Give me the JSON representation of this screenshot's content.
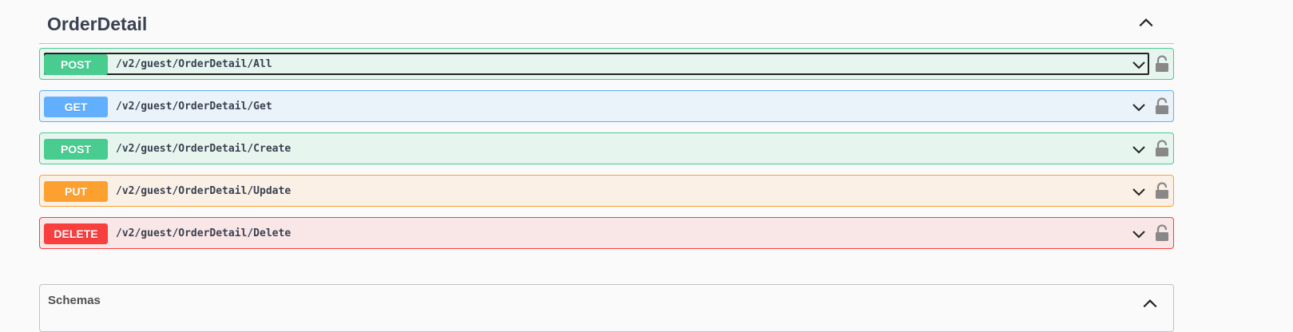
{
  "section": {
    "title": "OrderDetail"
  },
  "operations": [
    {
      "method": "POST",
      "path": "/v2/guest/OrderDetail/All",
      "color": "#49cc90"
    },
    {
      "method": "GET",
      "path": "/v2/guest/OrderDetail/Get",
      "color": "#61affe"
    },
    {
      "method": "POST",
      "path": "/v2/guest/OrderDetail/Create",
      "color": "#49cc90"
    },
    {
      "method": "PUT",
      "path": "/v2/guest/OrderDetail/Update",
      "color": "#fca130"
    },
    {
      "method": "DELETE",
      "path": "/v2/guest/OrderDetail/Delete",
      "color": "#f93e3e"
    }
  ],
  "schemas": {
    "title": "Schemas"
  },
  "icons": {
    "section_toggle": "chevron-up-icon",
    "operation_toggle": "chevron-down-icon",
    "auth": "lock-icon"
  }
}
